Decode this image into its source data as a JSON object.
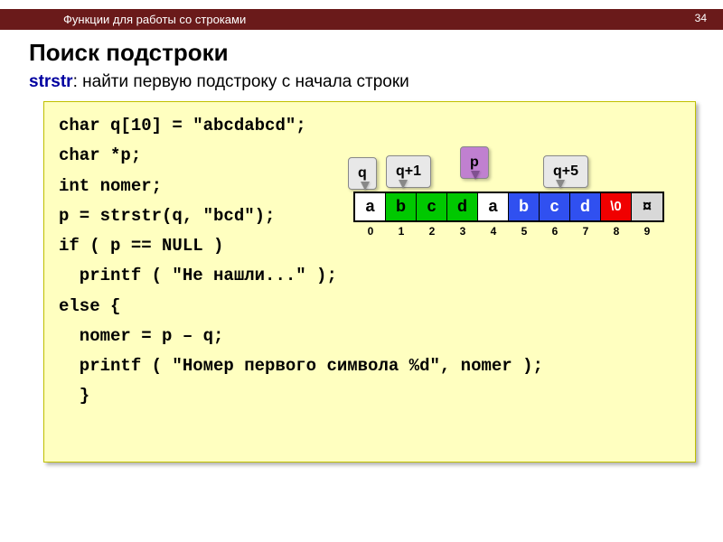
{
  "header": {
    "title": "Функции для работы со строками",
    "slide_number": "34"
  },
  "page": {
    "title": "Поиск подстроки",
    "subtitle_fn": "strstr",
    "subtitle_rest": ": найти первую подстроку с начала строки"
  },
  "code": {
    "l1": "char q[10] = \"abcdabcd\";",
    "l2": "char *p;",
    "l3": "int nomer;",
    "l4": "p = strstr(q, \"bcd\");",
    "l5": "if ( p == NULL )",
    "l6": "  printf ( \"Не нашли...\" );",
    "l7": "else {",
    "l8": "  nomer = p – q;",
    "l9": "  printf ( \"Номер первого символа %d\", nomer );",
    "l10": "  }"
  },
  "diagram": {
    "labels": {
      "q": "q",
      "q1": "q+1",
      "p": "p",
      "q5": "q+5"
    },
    "cells": [
      "a",
      "b",
      "c",
      "d",
      "a",
      "b",
      "c",
      "d",
      "\\0",
      "¤"
    ],
    "idx": [
      "0",
      "1",
      "2",
      "3",
      "4",
      "5",
      "6",
      "7",
      "8",
      "9"
    ]
  }
}
